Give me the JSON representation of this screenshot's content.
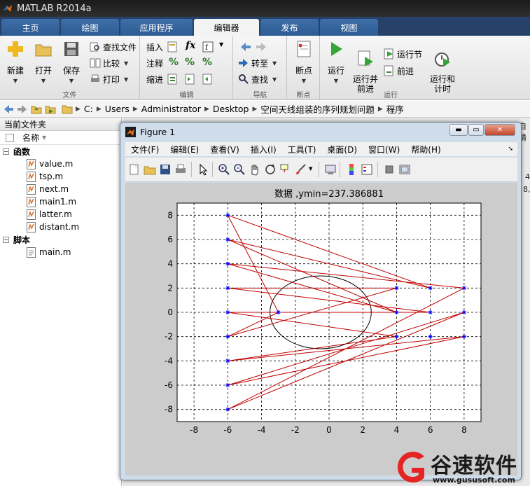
{
  "app": {
    "title": "MATLAB R2014a"
  },
  "tabs": [
    {
      "label": "主页",
      "active": false
    },
    {
      "label": "绘图",
      "active": false
    },
    {
      "label": "应用程序",
      "active": false
    },
    {
      "label": "编辑器",
      "active": true
    },
    {
      "label": "发布",
      "active": false
    },
    {
      "label": "视图",
      "active": false
    }
  ],
  "ribbon": {
    "file": {
      "label": "文件",
      "new": "新建",
      "open": "打开",
      "save": "保存",
      "find_files": "查找文件",
      "compare": "比较",
      "print": "打印"
    },
    "edit": {
      "label": "编辑",
      "insert": "插入",
      "comment": "注释",
      "indent": "缩进",
      "fx": "fx"
    },
    "nav": {
      "label": "导航",
      "goto": "转至",
      "find": "查找"
    },
    "breakpoint": {
      "label": "断点",
      "breakpoints": "断点"
    },
    "run": {
      "label": "运行",
      "run": "运行",
      "run_advance": "运行并\n前进",
      "run_section": "运行节",
      "advance": "前进",
      "run_time": "运行和\n计时"
    }
  },
  "address": {
    "crumbs": [
      "C:",
      "Users",
      "Administrator",
      "Desktop",
      "空间天线组装的序列规划问题",
      "程序"
    ]
  },
  "left_panel": {
    "title": "当前文件夹",
    "column_name": "名称",
    "groups": [
      {
        "label": "函数",
        "items": [
          "value.m",
          "tsp.m",
          "next.m",
          "main1.m",
          "latter.m",
          "distant.m"
        ]
      },
      {
        "label": "脚本",
        "items": [
          "main.m"
        ]
      }
    ]
  },
  "right_bg": {
    "frag1": "自请",
    "frag2": "4",
    "frag3": "8,"
  },
  "figure": {
    "title": "Figure 1",
    "menu": [
      "文件(F)",
      "编辑(E)",
      "查看(V)",
      "插入(I)",
      "工具(T)",
      "桌面(D)",
      "窗口(W)",
      "帮助(H)"
    ],
    "toolbar_icons": [
      "new-figure-icon",
      "open-icon",
      "save-icon",
      "print-icon",
      "pointer-icon",
      "zoom-in-icon",
      "zoom-out-icon",
      "pan-icon",
      "rotate-icon",
      "data-cursor-icon",
      "brush-icon",
      "link-icon",
      "colorbar-icon",
      "legend-icon",
      "hide-plot-tools-icon",
      "show-plot-tools-icon"
    ]
  },
  "chart_data": {
    "type": "scatter",
    "title": "数据 ,ymin=237.386881",
    "xlim": [
      -9,
      9
    ],
    "ylim": [
      -9,
      9
    ],
    "xticks": [
      -8,
      -6,
      -4,
      -2,
      0,
      2,
      4,
      6,
      8
    ],
    "yticks": [
      -8,
      -6,
      -4,
      -2,
      0,
      2,
      4,
      6,
      8
    ],
    "grid": true,
    "marker_color": "#0000ff",
    "line_color": "#c00000",
    "circle": {
      "center": [
        -0.5,
        0
      ],
      "radius": 3,
      "color": "#000000"
    },
    "points": [
      [
        -6,
        8
      ],
      [
        -6,
        6
      ],
      [
        -6,
        4
      ],
      [
        -6,
        2
      ],
      [
        -6,
        0
      ],
      [
        -6,
        -2
      ],
      [
        -6,
        -4
      ],
      [
        -6,
        -6
      ],
      [
        -6,
        -8
      ],
      [
        -3,
        0
      ],
      [
        4,
        2
      ],
      [
        4,
        0
      ],
      [
        4,
        -2
      ],
      [
        6,
        2
      ],
      [
        6,
        0
      ],
      [
        6,
        -2
      ],
      [
        8,
        2
      ],
      [
        8,
        0
      ],
      [
        8,
        -2
      ]
    ],
    "path": [
      [
        -6,
        8
      ],
      [
        6,
        2
      ],
      [
        -6,
        6
      ],
      [
        4,
        0
      ],
      [
        -6,
        4
      ],
      [
        8,
        2
      ],
      [
        -6,
        -8
      ],
      [
        8,
        0
      ],
      [
        -6,
        -6
      ],
      [
        8,
        -2
      ],
      [
        -6,
        -4
      ],
      [
        4,
        -2
      ],
      [
        -6,
        0
      ],
      [
        6,
        0
      ],
      [
        -6,
        2
      ],
      [
        4,
        2
      ],
      [
        -6,
        -2
      ],
      [
        -3,
        0
      ],
      [
        -6,
        8
      ]
    ]
  },
  "watermark": {
    "text": "谷速软件",
    "url": "www.gususoft.com"
  }
}
